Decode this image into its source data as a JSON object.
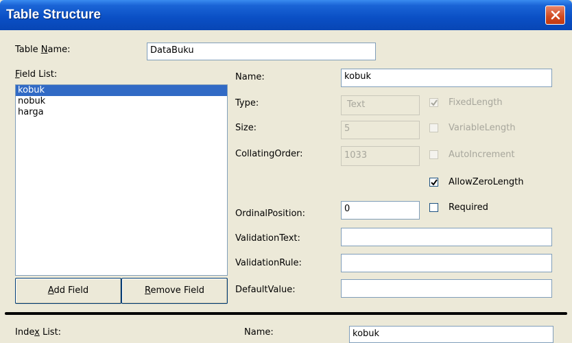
{
  "window": {
    "title": "Table Structure"
  },
  "table_name": {
    "label": "Table Name:",
    "value": "DataBuku"
  },
  "field_list": {
    "label": "Field List:",
    "items": [
      "kobuk",
      "nobuk",
      "harga"
    ],
    "selected": "kobuk"
  },
  "buttons": {
    "add_field": "Add Field",
    "remove_field": "Remove Field"
  },
  "field_props": {
    "name_label": "Name:",
    "name_value": "kobuk",
    "type_label": "Type:",
    "type_value": "Text",
    "size_label": "Size:",
    "size_value": "5",
    "collating_label": "CollatingOrder:",
    "collating_value": "1033",
    "ordinal_label": "OrdinalPosition:",
    "ordinal_value": "0",
    "validation_text_label": "ValidationText:",
    "validation_text_value": "",
    "validation_rule_label": "ValidationRule:",
    "validation_rule_value": "",
    "default_value_label": "DefaultValue:",
    "default_value_value": ""
  },
  "checkboxes": {
    "fixed_length": {
      "label": "FixedLength",
      "checked": true,
      "disabled": true
    },
    "variable_length": {
      "label": "VariableLength",
      "checked": false,
      "disabled": true
    },
    "auto_increment": {
      "label": "AutoIncrement",
      "checked": false,
      "disabled": true
    },
    "allow_zero_length": {
      "label": "AllowZeroLength",
      "checked": true,
      "disabled": false
    },
    "required": {
      "label": "Required",
      "checked": false,
      "disabled": false
    }
  },
  "index": {
    "list_label": "Index List:",
    "name_label": "Name:",
    "name_value": "kobuk"
  }
}
